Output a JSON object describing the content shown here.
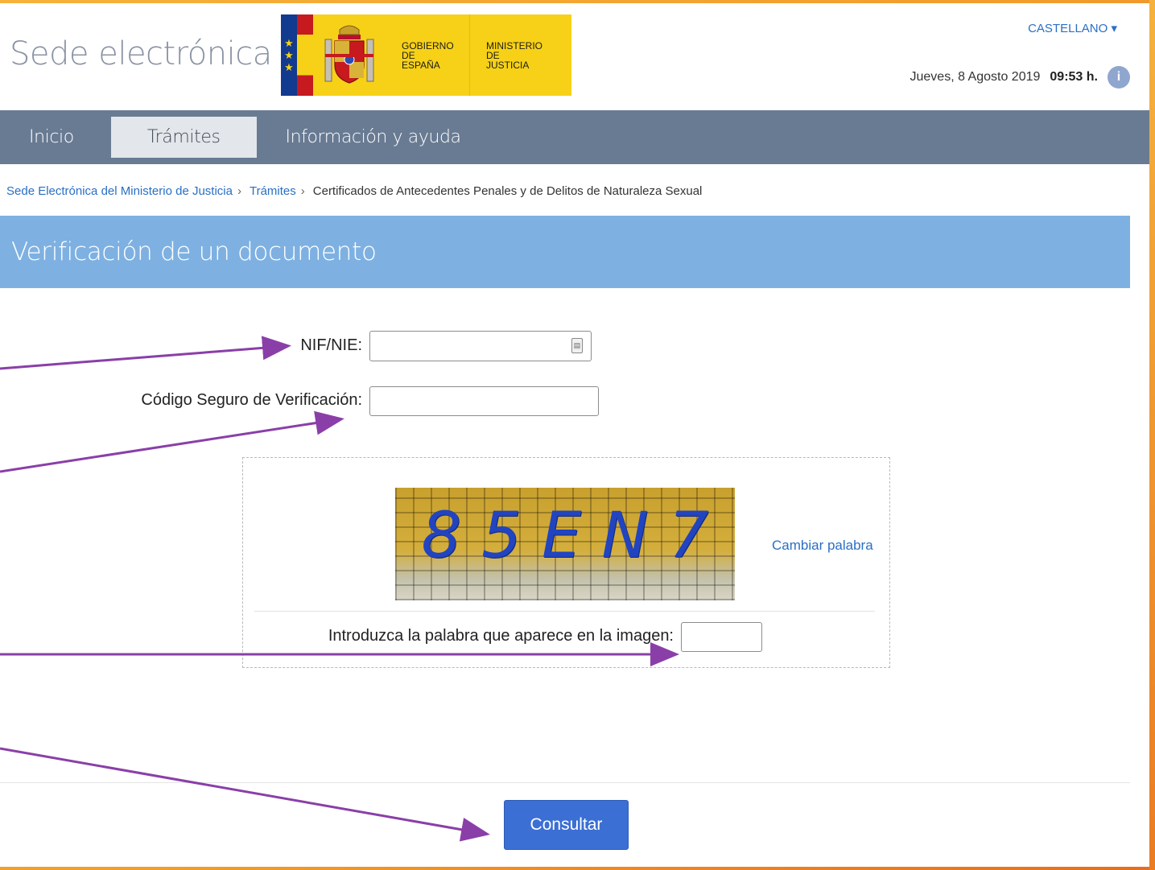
{
  "header": {
    "site_title": "Sede electrónica",
    "logo": {
      "gov_text": "Gobierno de España",
      "ministry_text": "Ministerio de Justicia"
    },
    "language": "CASTELLANO ▾",
    "date": "Jueves, 8 Agosto 2019",
    "time": "09:53 h.",
    "info_icon": "info-icon"
  },
  "nav": {
    "items": [
      {
        "label": "Inicio"
      },
      {
        "label": "Trámites",
        "active": true
      },
      {
        "label": "Información y ayuda"
      }
    ]
  },
  "breadcrumb": {
    "items": [
      {
        "label": "Sede Electrónica del Ministerio de Justicia",
        "sep": "›"
      },
      {
        "label": "Trámites",
        "sep": "›"
      },
      {
        "label": "Certificados de Antecedentes Penales y de Delitos de Naturaleza Sexual"
      }
    ]
  },
  "page": {
    "title": "Verificación de un documento"
  },
  "form": {
    "nif_label": "NIF/NIE:",
    "nif_value": "",
    "csv_label": "Código Seguro de Verificación:",
    "csv_value": "",
    "captcha": {
      "characters": [
        "8",
        "5",
        "E",
        "N",
        "7"
      ],
      "change_link": "Cambiar palabra",
      "prompt": "Introduzca la palabra que aparece en la imagen:",
      "value": ""
    },
    "submit_label": "Consultar"
  },
  "colors": {
    "nav_bg": "#697b93",
    "banner_bg": "#7eb1e2",
    "link": "#2a6fc4",
    "button": "#3b6fd4",
    "annotation_arrow": "#8a3fa8"
  }
}
